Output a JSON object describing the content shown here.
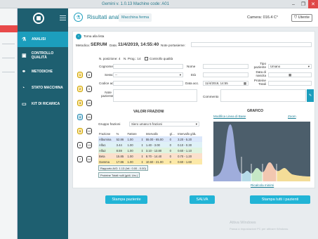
{
  "window": {
    "title": "Gemini v. 1.0.13       Machine code: A01",
    "min": "–",
    "max": "❐",
    "close": "✕"
  },
  "sidebar": {
    "items": [
      {
        "label": "ANALISI",
        "icon": "flask-icon",
        "glyph": "⚗"
      },
      {
        "label": "CONTROLLO QUALITÀ",
        "icon": "calendar-icon",
        "glyph": "▣"
      },
      {
        "label": "METODICHE",
        "icon": "link-icon",
        "glyph": "⚭"
      },
      {
        "label": "STATO MACCHINA",
        "icon": "gauge-icon",
        "glyph": "◔"
      },
      {
        "label": "KIT DI RICARICA",
        "icon": "kit-icon",
        "glyph": "▭"
      }
    ]
  },
  "header": {
    "title": "Risultati analisi",
    "tag": "Macchina ferma",
    "camera": "Camera: 016.4 C°",
    "user": "Utente"
  },
  "panel": {
    "back_label": "Torna alla lista",
    "metodica_label": "Metodica:",
    "metodica_value": "SERUM",
    "data_label": "Data:",
    "data_value": "11/4/2019, 14:55:40",
    "note_label": "Note portasieme:",
    "posizione": "N. posizione: 4",
    "prog": "N. Prog.: 14",
    "cq": "Controllo qualità",
    "cognome_label": "Cognome",
    "nome_label": "Nome",
    "tipo_label": "Tipo paziente",
    "tipo_value": "Umano",
    "sesso_label": "Sesso",
    "sesso_value": "--",
    "eta_label": "Età",
    "nascita_label": "Data di nascita",
    "codice_label": "Codice acc.",
    "data_acc_label": "Data acc.",
    "data_acc_value": "11/4/2019, 14:55",
    "proteine_label": "Proteine Totali",
    "notep_label": "Note paziente",
    "commento_label": "Commento",
    "valori_title": "VALORI FRAZIONI",
    "grafico_title": "GRAFICO",
    "gruppo_label": "Gruppo frazioni",
    "gruppo_value": "Siero umano 5 frazioni",
    "modifica_link": "Modifica Linea di Base",
    "zoom_link": "Zoom",
    "ricalcola_link": "Ricalcola minimi",
    "rapporto": "Rapporto A/G: 1.13 (Inf.: 0.00 - 0.00)",
    "proteine_btn": "Proteine Totali nulli (g/dL Urc.)",
    "stampa_paziente": "Stampa paziente",
    "salva": "SALVA",
    "stampa_tutti": "Stampa tutti i pazienti"
  },
  "pills": [
    {
      "id": "1",
      "c": "y"
    },
    {
      "id": "2",
      "c": "y"
    },
    {
      "id": "3",
      "c": "y"
    },
    {
      "id": "4",
      "c": "b"
    },
    {
      "id": "5",
      "c": "y"
    },
    {
      "id": "6",
      "c": "w"
    },
    {
      "id": "7",
      "c": "w"
    },
    {
      "id": "8",
      "c": "w"
    },
    {
      "id": "9",
      "c": "w"
    },
    {
      "id": "10",
      "c": "w"
    },
    {
      "id": "11",
      "c": "w"
    },
    {
      "id": "12",
      "c": "w"
    },
    {
      "id": "13",
      "c": "w"
    },
    {
      "id": "14",
      "c": "w"
    }
  ],
  "fractions": {
    "headers": [
      "Frazione",
      "%",
      "Fattore",
      "",
      "Intervallo",
      "g/...",
      "Intervallo g/dL"
    ],
    "rows": [
      {
        "name": "Albumina",
        "pct": "52.86",
        "factor": "1.00",
        "range": "55.00 - 65.00",
        "gdl": "0",
        "range_gdl": "3.20 - 5.20"
      },
      {
        "name": "Alfa1",
        "pct": "3.44",
        "factor": "1.00",
        "range": "1.40 - 3.00",
        "gdl": "0",
        "range_gdl": "0.10 - 0.30"
      },
      {
        "name": "Alfa2",
        "pct": "8.59",
        "factor": "1.00",
        "range": "3.10 - 13.80",
        "gdl": "0",
        "range_gdl": "0.60 - 1.10"
      },
      {
        "name": "Beta",
        "pct": "15.85",
        "factor": "1.00",
        "range": "8.70 - 14.40",
        "gdl": "0",
        "range_gdl": "0.70 - 1.20"
      },
      {
        "name": "Gamma",
        "pct": "17.86",
        "factor": "1.00",
        "range": "10.60 - 21.00",
        "gdl": "0",
        "range_gdl": "0.60 - 1.60"
      }
    ]
  },
  "watermark": {
    "line1": "Attiva Windows",
    "line2": "Passa a Impostazioni PC per attivare Windows."
  }
}
